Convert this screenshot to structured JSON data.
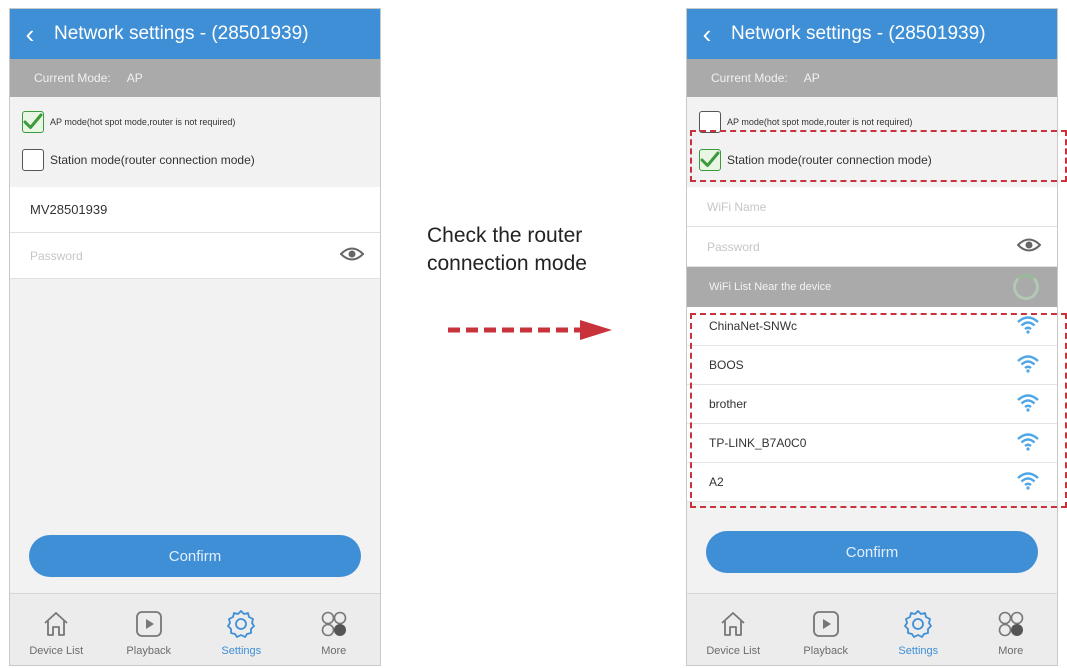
{
  "colors": {
    "accent": "#3f8fd6",
    "mode_bar": "#aaaaaa",
    "checkbox_green": "#3b9a3b",
    "annotation_red": "#c8323a"
  },
  "annotation": {
    "line1": "Check the router",
    "line2": "connection mode"
  },
  "left_phone": {
    "back_icon": "chevron-left-icon",
    "title": "Network settings  - (28501939)",
    "current_mode_label": "Current Mode:",
    "current_mode_value": "AP",
    "ap_mode": {
      "label": "AP mode(hot spot mode,router is not required)",
      "checked": true
    },
    "station_mode": {
      "label": "Station mode(router connection mode)",
      "checked": false
    },
    "ssid_value": "MV28501939",
    "password_placeholder": "Password",
    "eye_icon": "eye-icon",
    "confirm_label": "Confirm"
  },
  "right_phone": {
    "back_icon": "chevron-left-icon",
    "title": "Network settings  - (28501939)",
    "current_mode_label": "Current Mode:",
    "current_mode_value": "AP",
    "ap_mode": {
      "label": "AP mode(hot spot mode,router is not required)",
      "checked": false
    },
    "station_mode": {
      "label": "Station mode(router connection mode)",
      "checked": true
    },
    "wifi_name_placeholder": "WiFi Name",
    "password_placeholder": "Password",
    "eye_icon": "eye-icon",
    "wifi_list_header": "WiFi List Near the device",
    "wifi_list": [
      {
        "name": "ChinaNet-SNWc",
        "icon": "wifi-signal-icon"
      },
      {
        "name": "BOOS",
        "icon": "wifi-signal-icon"
      },
      {
        "name": "brother",
        "icon": "wifi-signal-icon"
      },
      {
        "name": "TP-LINK_B7A0C0",
        "icon": "wifi-signal-icon"
      },
      {
        "name": "A2",
        "icon": "wifi-signal-icon"
      }
    ],
    "confirm_label": "Confirm"
  },
  "tabs": [
    {
      "label": "Device List",
      "icon": "home-icon",
      "active": false
    },
    {
      "label": "Playback",
      "icon": "play-icon",
      "active": false
    },
    {
      "label": "Settings",
      "icon": "gear-icon",
      "active": true
    },
    {
      "label": "More",
      "icon": "more-circles-icon",
      "active": false
    }
  ]
}
